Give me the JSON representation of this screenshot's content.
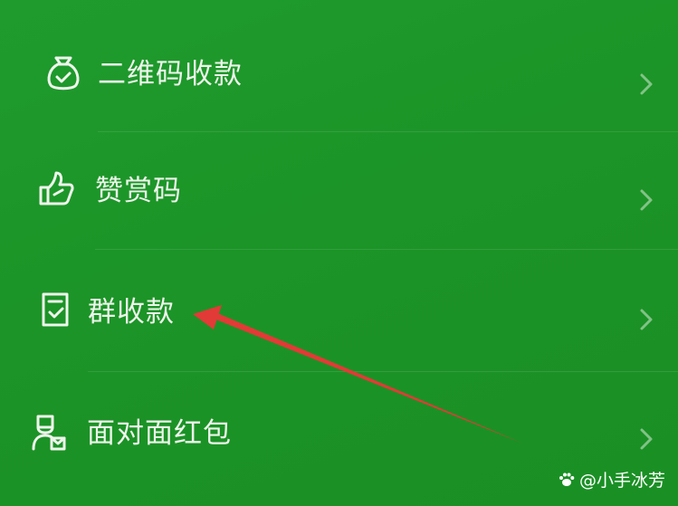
{
  "menu": {
    "items": [
      {
        "label": "二维码收款",
        "icon": "money-bag-icon",
        "chevron": "chevron-right-icon"
      },
      {
        "label": "赞赏码",
        "icon": "thumbs-up-icon",
        "chevron": "chevron-right-icon"
      },
      {
        "label": "群收款",
        "icon": "checklist-doc-icon",
        "chevron": "chevron-right-icon"
      },
      {
        "label": "面对面红包",
        "icon": "people-envelope-icon",
        "chevron": "chevron-right-icon"
      }
    ]
  },
  "annotation": {
    "color": "#e23a36",
    "points_to": "群收款"
  },
  "watermark": {
    "text": "@小手冰芳",
    "icon": "paw-icon"
  },
  "colors": {
    "background": "#1c9427",
    "text": "#eef5ec"
  }
}
